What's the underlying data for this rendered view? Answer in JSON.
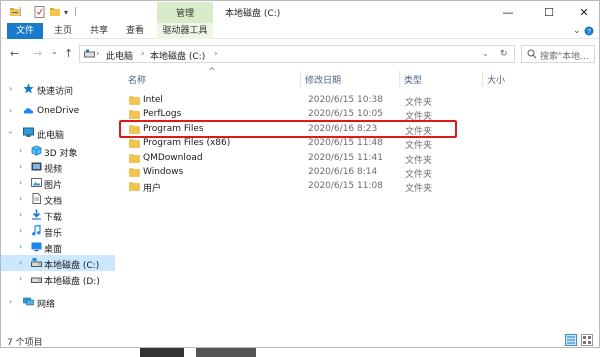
{
  "window": {
    "title": "本地磁盘 (C:)",
    "context_tab": "管理",
    "controls": {
      "minimize": "—",
      "maximize": "☐",
      "close": "✕"
    }
  },
  "ribbon": {
    "tabs": [
      "文件",
      "主页",
      "共享",
      "查看",
      "驱动器工具"
    ],
    "right_icons": [
      "chevron-down-icon",
      "help-icon"
    ]
  },
  "address_bar": {
    "segments": [
      "此电脑",
      "本地磁盘 (C:)"
    ],
    "search_placeholder": "搜索\"本地..."
  },
  "nav_pane": {
    "items": [
      {
        "label": "快速访问",
        "icon": "star-icon"
      },
      {
        "label": "OneDrive",
        "icon": "cloud-icon"
      },
      {
        "label": "此电脑",
        "icon": "computer-icon"
      },
      {
        "label": "3D 对象",
        "icon": "cube-icon"
      },
      {
        "label": "视频",
        "icon": "video-icon"
      },
      {
        "label": "图片",
        "icon": "picture-icon"
      },
      {
        "label": "文档",
        "icon": "document-icon"
      },
      {
        "label": "下载",
        "icon": "download-icon"
      },
      {
        "label": "音乐",
        "icon": "music-icon"
      },
      {
        "label": "桌面",
        "icon": "desktop-icon"
      },
      {
        "label": "本地磁盘 (C:)",
        "icon": "drive-icon",
        "selected": true
      },
      {
        "label": "本地磁盘 (D:)",
        "icon": "drive-icon"
      },
      {
        "label": "网络",
        "icon": "network-icon"
      }
    ]
  },
  "file_list": {
    "columns": [
      "名称",
      "修改日期",
      "类型",
      "大小"
    ],
    "rows": [
      {
        "name": "Intel",
        "date": "2020/6/15 10:38",
        "type": "文件夹"
      },
      {
        "name": "PerfLogs",
        "date": "2020/6/15 10:05",
        "type": "文件夹"
      },
      {
        "name": "Program Files",
        "date": "2020/6/16 8:23",
        "type": "文件夹",
        "highlighted": true
      },
      {
        "name": "Program Files (x86)",
        "date": "2020/6/15 11:48",
        "type": "文件夹"
      },
      {
        "name": "QMDownload",
        "date": "2020/6/15 11:41",
        "type": "文件夹"
      },
      {
        "name": "Windows",
        "date": "2020/6/16 8:14",
        "type": "文件夹"
      },
      {
        "name": "用户",
        "date": "2020/6/15 11:08",
        "type": "文件夹"
      }
    ]
  },
  "status_bar": {
    "item_count": "7 个项目"
  },
  "colors": {
    "accent": "#1979ca",
    "highlight_box": "#e01818",
    "folder": "#f3c44e",
    "selection": "#cce8ff",
    "context_tab": "#d9ecc9"
  }
}
